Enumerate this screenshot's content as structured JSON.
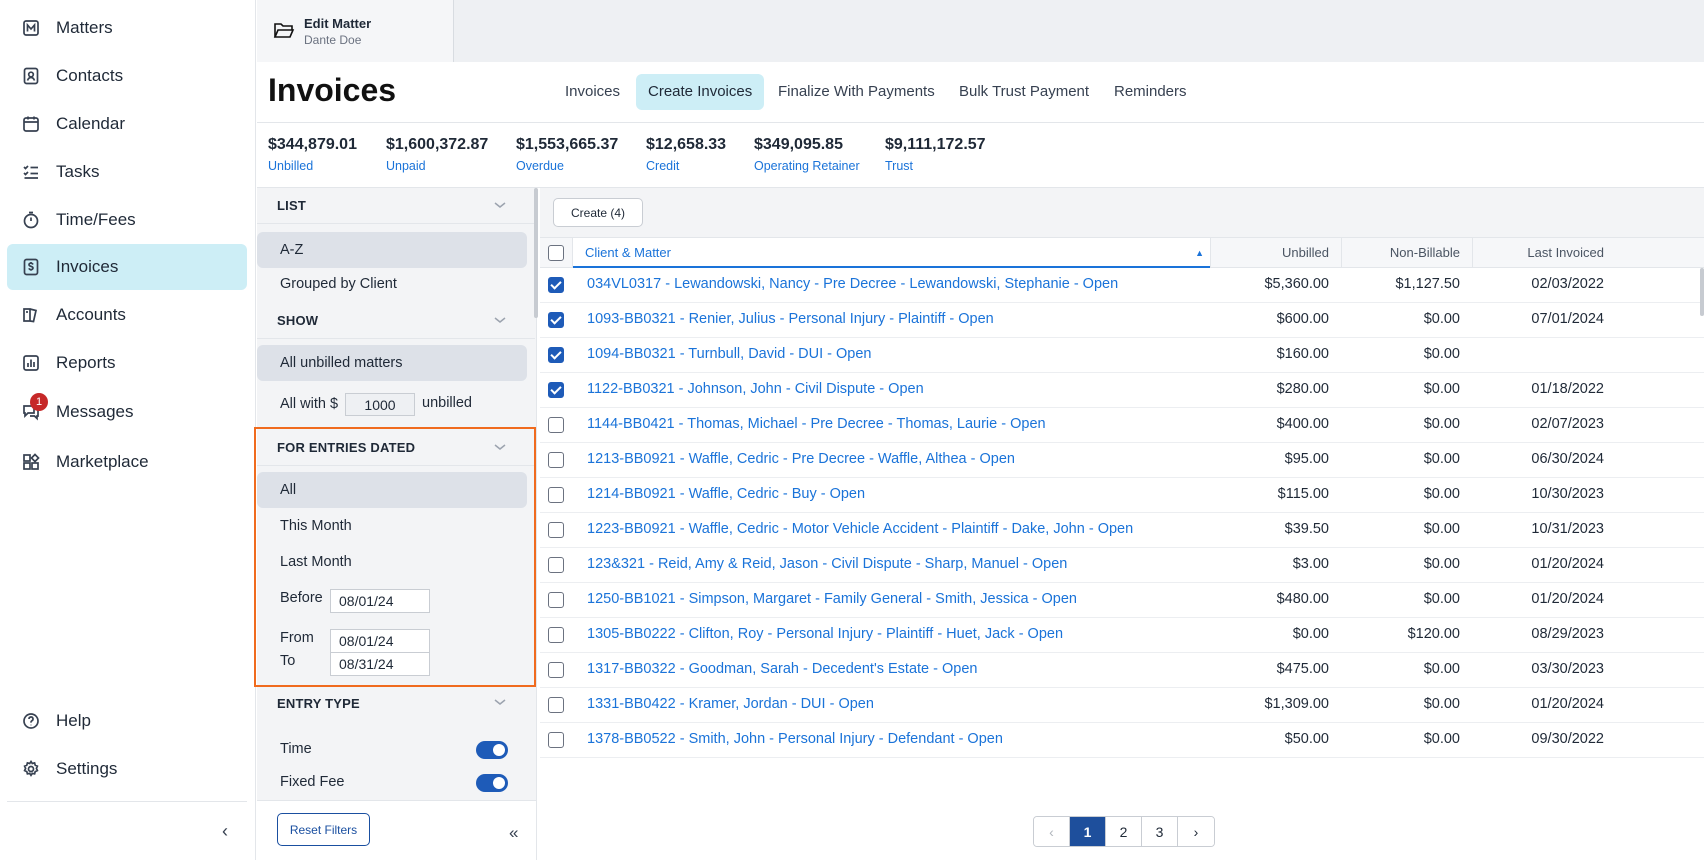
{
  "nav": {
    "items": [
      {
        "label": "Matters",
        "icon": "matters-icon"
      },
      {
        "label": "Contacts",
        "icon": "contacts-icon"
      },
      {
        "label": "Calendar",
        "icon": "calendar-icon"
      },
      {
        "label": "Tasks",
        "icon": "tasks-icon"
      },
      {
        "label": "Time/Fees",
        "icon": "stopwatch-icon"
      },
      {
        "label": "Invoices",
        "icon": "invoice-icon"
      },
      {
        "label": "Accounts",
        "icon": "accounts-icon"
      },
      {
        "label": "Reports",
        "icon": "reports-icon"
      },
      {
        "label": "Messages",
        "icon": "messages-icon",
        "badge": "1"
      },
      {
        "label": "Marketplace",
        "icon": "marketplace-icon"
      }
    ],
    "help": "Help",
    "settings": "Settings",
    "active": "Invoices"
  },
  "topbar": {
    "edit_matter": "Edit Matter",
    "matter_name": "Dante Doe"
  },
  "page": {
    "title": "Invoices"
  },
  "tabs": [
    "Invoices",
    "Create Invoices",
    "Finalize With Payments",
    "Bulk Trust Payment",
    "Reminders"
  ],
  "active_tab": "Create Invoices",
  "summary": [
    {
      "amount": "$344,879.01",
      "label": "Unbilled"
    },
    {
      "amount": "$1,600,372.87",
      "label": "Unpaid"
    },
    {
      "amount": "$1,553,665.37",
      "label": "Overdue"
    },
    {
      "amount": "$12,658.33",
      "label": "Credit"
    },
    {
      "amount": "$349,095.85",
      "label": "Operating Retainer"
    },
    {
      "amount": "$9,111,172.57",
      "label": "Trust"
    }
  ],
  "filters": {
    "list": {
      "heading": "LIST",
      "options": [
        "A-Z",
        "Grouped by Client"
      ],
      "selected": "A-Z"
    },
    "show": {
      "heading": "SHOW",
      "options": [
        "All unbilled matters"
      ],
      "all_with_prefix": "All with $",
      "all_with_value": "1000",
      "all_with_suffix": "unbilled",
      "selected": "All unbilled matters"
    },
    "entries_dated": {
      "heading": "FOR ENTRIES DATED",
      "options": [
        "All",
        "This Month",
        "Last Month"
      ],
      "selected": "All",
      "before_label": "Before",
      "before_value": "08/01/24",
      "from_label": "From",
      "from_value": "08/01/24",
      "to_label": "To",
      "to_value": "08/31/24"
    },
    "entry_type": {
      "heading": "ENTRY TYPE",
      "items": [
        {
          "label": "Time",
          "on": true
        },
        {
          "label": "Fixed Fee",
          "on": true
        }
      ]
    },
    "reset": "Reset Filters",
    "highlight_color": "#f06b1e"
  },
  "toolbar": {
    "create_label": "Create (4)"
  },
  "table": {
    "columns": [
      "Client & Matter",
      "Unbilled",
      "Non-Billable",
      "Last Invoiced"
    ],
    "sorted_column": "Client & Matter",
    "rows": [
      {
        "checked": true,
        "matter": "034VL0317 - Lewandowski, Nancy - Pre Decree - Lewandowski, Stephanie - Open",
        "unbilled": "$5,360.00",
        "nonbillable": "$1,127.50",
        "last_invoiced": "02/03/2022"
      },
      {
        "checked": true,
        "matter": "1093-BB0321 - Renier, Julius - Personal Injury - Plaintiff - Open",
        "unbilled": "$600.00",
        "nonbillable": "$0.00",
        "last_invoiced": "07/01/2024"
      },
      {
        "checked": true,
        "matter": "1094-BB0321 - Turnbull, David - DUI - Open",
        "unbilled": "$160.00",
        "nonbillable": "$0.00",
        "last_invoiced": ""
      },
      {
        "checked": true,
        "matter": "1122-BB0321 - Johnson, John - Civil Dispute - Open",
        "unbilled": "$280.00",
        "nonbillable": "$0.00",
        "last_invoiced": "01/18/2022"
      },
      {
        "checked": false,
        "matter": "1144-BB0421 - Thomas, Michael - Pre Decree - Thomas, Laurie - Open",
        "unbilled": "$400.00",
        "nonbillable": "$0.00",
        "last_invoiced": "02/07/2023"
      },
      {
        "checked": false,
        "matter": "1213-BB0921 - Waffle, Cedric - Pre Decree - Waffle, Althea - Open",
        "unbilled": "$95.00",
        "nonbillable": "$0.00",
        "last_invoiced": "06/30/2024"
      },
      {
        "checked": false,
        "matter": "1214-BB0921 - Waffle, Cedric - Buy - Open",
        "unbilled": "$115.00",
        "nonbillable": "$0.00",
        "last_invoiced": "10/30/2023"
      },
      {
        "checked": false,
        "matter": "1223-BB0921 - Waffle, Cedric - Motor Vehicle Accident - Plaintiff - Dake, John - Open",
        "unbilled": "$39.50",
        "nonbillable": "$0.00",
        "last_invoiced": "10/31/2023"
      },
      {
        "checked": false,
        "matter": "123&321 - Reid, Amy & Reid, Jason - Civil Dispute - Sharp, Manuel - Open",
        "unbilled": "$3.00",
        "nonbillable": "$0.00",
        "last_invoiced": "01/20/2024"
      },
      {
        "checked": false,
        "matter": "1250-BB1021 - Simpson, Margaret - Family General - Smith, Jessica - Open",
        "unbilled": "$480.00",
        "nonbillable": "$0.00",
        "last_invoiced": "01/20/2024"
      },
      {
        "checked": false,
        "matter": "1305-BB0222 - Clifton, Roy - Personal Injury - Plaintiff - Huet, Jack - Open",
        "unbilled": "$0.00",
        "nonbillable": "$120.00",
        "last_invoiced": "08/29/2023"
      },
      {
        "checked": false,
        "matter": "1317-BB0322 - Goodman, Sarah - Decedent's Estate - Open",
        "unbilled": "$475.00",
        "nonbillable": "$0.00",
        "last_invoiced": "03/30/2023"
      },
      {
        "checked": false,
        "matter": "1331-BB0422 - Kramer, Jordan - DUI - Open",
        "unbilled": "$1,309.00",
        "nonbillable": "$0.00",
        "last_invoiced": "01/20/2024"
      },
      {
        "checked": false,
        "matter": "1378-BB0522 - Smith, John - Personal Injury - Defendant - Open",
        "unbilled": "$50.00",
        "nonbillable": "$0.00",
        "last_invoiced": "09/30/2022"
      }
    ]
  },
  "pagination": {
    "prev": "‹",
    "pages": [
      "1",
      "2",
      "3"
    ],
    "current": "1",
    "next": "›"
  },
  "colors": {
    "accent": "#1a73d9",
    "active_bg": "#cdeef6",
    "primary": "#1e4f9c"
  }
}
